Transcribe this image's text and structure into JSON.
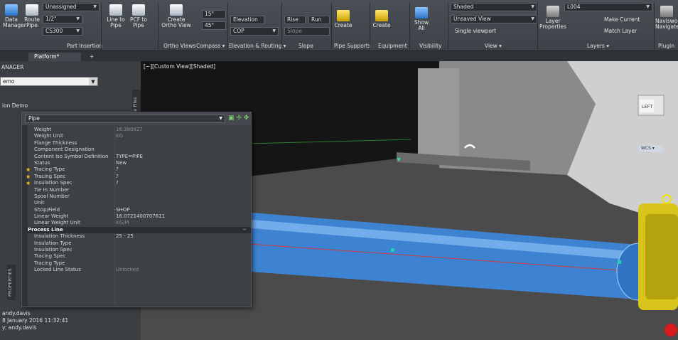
{
  "ribbon": {
    "data_manager": "Data\nManager",
    "route_pipe": "Route\nPipe",
    "spec_combo": "Unassigned",
    "size_combo": "1/2\"",
    "pipe_spec_combo": "CS300",
    "line_to_pipe": "Line to\nPipe",
    "pcf_to_pipe": "PCF to\nPipe",
    "create_ortho_view": "Create\nOrtho View",
    "angle_combo": "15°",
    "angle_combo2": "45°",
    "elevation_combo": "Elevation",
    "cop_combo": "COP",
    "rise": "Rise",
    "run": "Run",
    "slope": "Slope",
    "create_supports": "Create",
    "create_equipment": "Create",
    "show_all": "Show\nAll",
    "visual_style_combo": "Shaded",
    "view_combo": "Unsaved View",
    "single_viewport": "Single viewport",
    "layer_properties": "Layer\nProperties",
    "layer_combo": "L004",
    "make_current": "Make Current",
    "match_layer": "Match Layer",
    "navisworks": "Naviswork\nNavigate",
    "panels": {
      "part_insertion": "Part Insertion",
      "ortho_views": "Ortho Views",
      "compass": "Compass ▾",
      "elev_routing": "Elevation & Routing ▾",
      "slope": "Slope",
      "pipe_supports": "Pipe Supports",
      "equipment": "Equipment",
      "visibility": "Visibility",
      "view": "View ▾",
      "layers": "Layers ▾",
      "plugin": "Plugin"
    }
  },
  "tabs": {
    "platform": "Platform*",
    "add": "+"
  },
  "left_panel": {
    "title": "ANAGER",
    "combo": "emo",
    "node": "ion Demo",
    "side_tab": "Source Files",
    "props_tab": "PROPERTIES",
    "footer": [
      "andy.davis",
      "8 January 2016 11:32:41",
      "y: andy.davis"
    ]
  },
  "viewport": {
    "label": "[−][Custom View][Shaded]",
    "viewcube_face": "LEFT",
    "wcs": "WCS ▾"
  },
  "palette": {
    "object_type": "Pipe",
    "rows": [
      {
        "k": "Weight",
        "v": "16.380827",
        "dim": true
      },
      {
        "k": "Weight Unit",
        "v": "KG",
        "dim": true
      },
      {
        "k": "Flange Thickness",
        "v": ""
      },
      {
        "k": "Component Designation",
        "v": ""
      },
      {
        "k": "Content Iso Symbol Definition",
        "v": "TYPE=PIPE"
      },
      {
        "k": "Status",
        "v": "New"
      },
      {
        "k": "Tracing Type",
        "v": "?",
        "star": true
      },
      {
        "k": "Tracing Spec",
        "v": "?",
        "star": true
      },
      {
        "k": "Insulation Spec",
        "v": "?",
        "star": true
      },
      {
        "k": "Tie In Number",
        "v": ""
      },
      {
        "k": "Spool Number",
        "v": ""
      },
      {
        "k": "Unit",
        "v": ""
      },
      {
        "k": "Shop/Field",
        "v": "SHOP"
      },
      {
        "k": "Linear Weight",
        "v": "16.0721400707611"
      },
      {
        "k": "Linear Weight Unit",
        "v": "KG/M",
        "dim": true
      }
    ],
    "section": "Process Line",
    "section_rows": [
      {
        "k": "Insulation Thickness",
        "v": "25 - 25"
      },
      {
        "k": "Insulation Type",
        "v": ""
      },
      {
        "k": "Insulation Spec",
        "v": ""
      },
      {
        "k": "Tracing Spec",
        "v": ""
      },
      {
        "k": "Tracing Type",
        "v": ""
      },
      {
        "k": "Locked Line Status",
        "v": "Unlocked",
        "dim": true
      }
    ]
  }
}
